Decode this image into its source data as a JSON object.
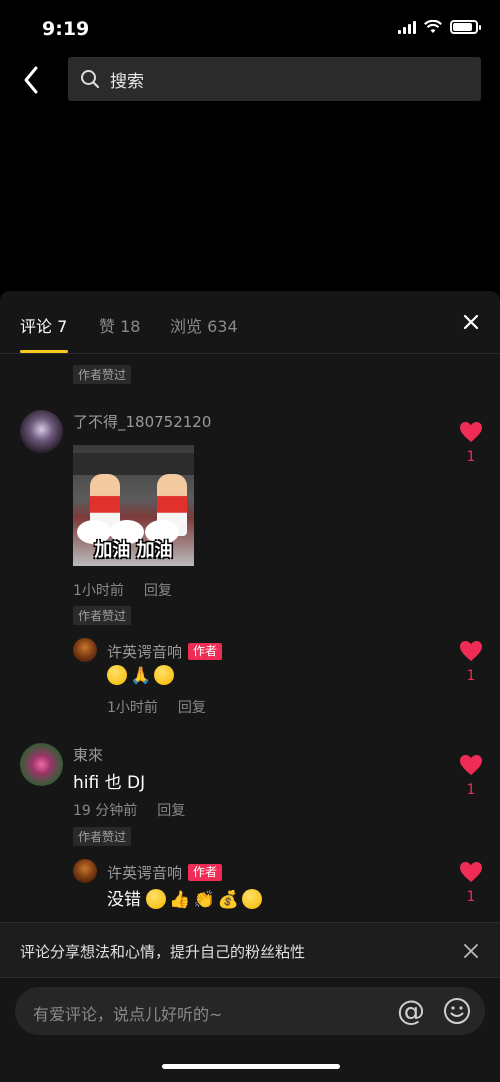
{
  "status": {
    "time": "9:19"
  },
  "search": {
    "placeholder": "搜索"
  },
  "tabs": [
    {
      "label": "评论 7"
    },
    {
      "label": "赞 18"
    },
    {
      "label": "浏览 634"
    }
  ],
  "comments": {
    "top_tag": "作者赞过",
    "c1": {
      "user": "了不得_180752120",
      "gif_caption": "加油 加油",
      "time": "1小时前",
      "reply": "回复",
      "tag": "作者赞过",
      "likes": "1"
    },
    "r1": {
      "user": "许英谔音响",
      "badge": "作者",
      "time": "1小时前",
      "reply": "回复",
      "likes": "1"
    },
    "c2": {
      "user": "東來",
      "text": "hifi 也 DJ",
      "time": "19 分钟前",
      "reply": "回复",
      "tag": "作者赞过",
      "likes": "1"
    },
    "r2": {
      "user": "许英谔音响",
      "badge": "作者",
      "text": "没错",
      "likes": "1"
    }
  },
  "hint": {
    "text": "评论分享想法和心情，提升自己的粉丝粘性"
  },
  "input": {
    "placeholder": "有爱评论，说点儿好听的~",
    "at_symbol": "@"
  },
  "colors": {
    "accent": "#f8c920",
    "like": "#ee2c55",
    "sheet_bg": "#161616"
  }
}
